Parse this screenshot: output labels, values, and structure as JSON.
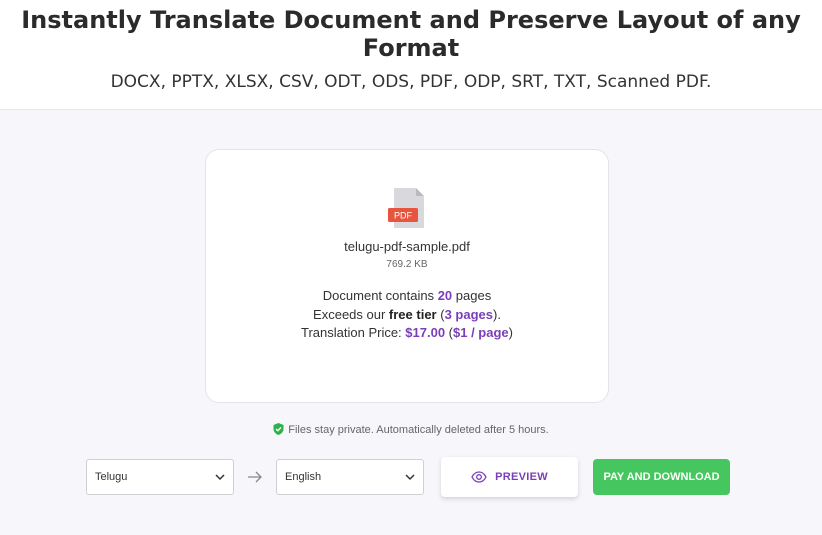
{
  "header": {
    "title": "Instantly Translate Document and Preserve Layout of any Format",
    "subtitle": "DOCX, PPTX, XLSX, CSV, ODT, ODS, PDF, ODP, SRT, TXT, Scanned PDF."
  },
  "file": {
    "icon": "pdf-file-icon",
    "badge": "PDF",
    "name": "telugu-pdf-sample.pdf",
    "size": "769.2 KB"
  },
  "info": {
    "line1_prefix": "Document contains ",
    "page_count": "20",
    "line1_suffix": " pages",
    "line2_prefix": "Exceeds our ",
    "free_tier": "free tier",
    "line2_mid": " (",
    "free_pages": "3 pages",
    "line2_suffix": ").",
    "line3_prefix": "Translation Price: ",
    "price": "$17.00",
    "line3_mid": " (",
    "per_page": "$1 / page",
    "line3_suffix": ")"
  },
  "privacy": {
    "icon": "shield-check-icon",
    "text": "Files stay private. Automatically deleted after 5 hours."
  },
  "controls": {
    "source_language": "Telugu",
    "target_language": "English",
    "preview_label": "PREVIEW",
    "pay_label": "PAY AND DOWNLOAD"
  },
  "colors": {
    "accent": "#7a3fb8",
    "pay_button": "#46c65e",
    "pdf_badge": "#e8553e",
    "shield": "#2bb24c"
  }
}
